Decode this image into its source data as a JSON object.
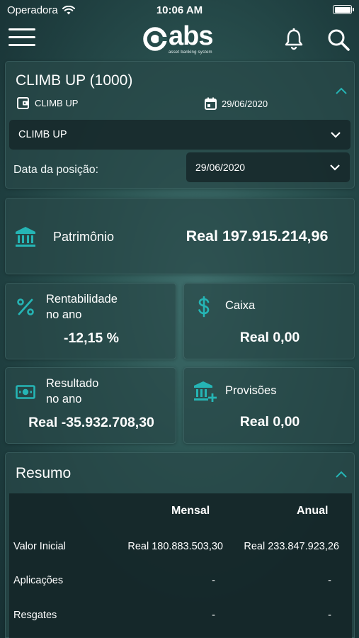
{
  "status_bar": {
    "carrier": "Operadora",
    "time": "10:06 AM"
  },
  "header": {
    "logo_text": "abs",
    "logo_subtitle": "asset banking system"
  },
  "fund": {
    "title": "CLIMB UP (1000)",
    "wallet_label": "CLIMB UP",
    "date_label": "29/06/2020",
    "fund_select_value": "CLIMB UP",
    "position_date_label": "Data da posição:",
    "position_date_value": "29/06/2020"
  },
  "patrimonio": {
    "label": "Patrimônio",
    "value": "Real 197.915.214,96"
  },
  "stats": {
    "rentabilidade_label_1": "Rentabilidade",
    "rentabilidade_label_2": "no ano",
    "rentabilidade_value": "-12,15 %",
    "caixa_label": "Caixa",
    "caixa_value": "Real 0,00",
    "resultado_label_1": "Resultado",
    "resultado_label_2": "no ano",
    "resultado_value": "Real -35.932.708,30",
    "provisoes_label": "Provisões",
    "provisoes_value": "Real 0,00"
  },
  "summary": {
    "title": "Resumo",
    "col_mensal": "Mensal",
    "col_anual": "Anual",
    "rows": [
      {
        "label": "Valor Inicial",
        "mensal": "Real 180.883.503,30",
        "anual": "Real 233.847.923,26"
      },
      {
        "label": "Aplicações",
        "mensal": "-",
        "anual": "-"
      },
      {
        "label": "Resgates",
        "mensal": "-",
        "anual": "-"
      }
    ]
  },
  "colors": {
    "accent": "#25b5b5",
    "background": "#2c5553"
  },
  "icons": [
    "wifi-icon",
    "battery-icon",
    "menu-icon",
    "bell-icon",
    "search-icon",
    "wallet-icon",
    "calendar-icon",
    "chevron-up-icon",
    "chevron-down-icon",
    "bank-icon",
    "percent-icon",
    "dollar-icon",
    "money-icon",
    "provisions-icon"
  ]
}
